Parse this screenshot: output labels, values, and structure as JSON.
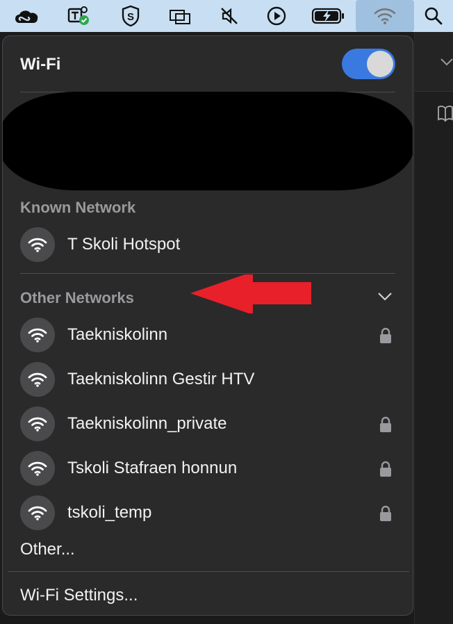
{
  "menubar": {
    "icons": [
      "creative-cloud-icon",
      "teams-icon",
      "s-shield-icon",
      "display-mirror-icon",
      "mute-icon",
      "play-icon",
      "battery-charging-icon",
      "wifi-icon",
      "search-icon"
    ],
    "background": "#c8dff3",
    "active_background": "#9fc1df"
  },
  "wifi_menu": {
    "title": "Wi-Fi",
    "toggle_on": true,
    "toggle_color": "#3a7ae0",
    "known_label": "Known Network",
    "known_networks": [
      {
        "name": "T Skoli Hotspot",
        "locked": false
      }
    ],
    "other_label": "Other Networks",
    "other_networks": [
      {
        "name": "Taekniskolinn",
        "locked": true
      },
      {
        "name": "Taekniskolinn Gestir HTV",
        "locked": false
      },
      {
        "name": "Taekniskolinn_private",
        "locked": true
      },
      {
        "name": "Tskoli Stafraen honnun",
        "locked": true
      },
      {
        "name": "tskoli_temp",
        "locked": true
      }
    ],
    "other_item": "Other...",
    "settings_item": "Wi-Fi Settings..."
  },
  "annotation": {
    "arrow_color": "#e8202a",
    "points_to": "Taekniskolinn"
  }
}
